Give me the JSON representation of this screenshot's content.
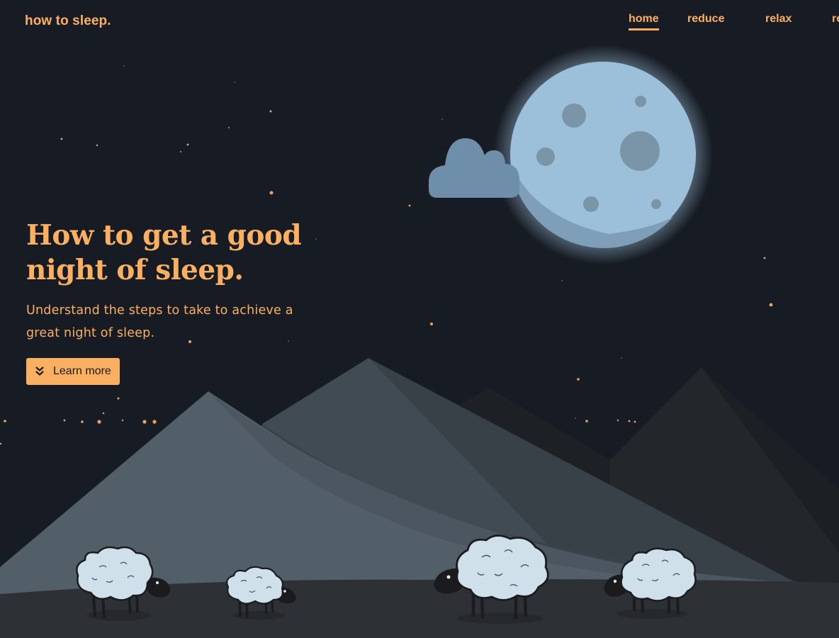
{
  "brand": {
    "name": "how to sleep."
  },
  "nav": {
    "items": [
      {
        "label": "home",
        "active": true
      },
      {
        "label": "reduce",
        "active": false
      },
      {
        "label": "relax",
        "active": false
      },
      {
        "label": "rest",
        "active": false
      }
    ]
  },
  "hero": {
    "title": "How to get a good night of sleep.",
    "subtitle": "Understand the steps to take to achieve a great night of sleep.",
    "cta_label": "Learn more",
    "cta_icon": "double-chevron-down-icon"
  },
  "colors": {
    "background": "#171b23",
    "accent": "#fbb061",
    "moon": "#9dc0da",
    "cloud": "#6f8ea9",
    "sheep_wool": "#cfe0ea"
  }
}
